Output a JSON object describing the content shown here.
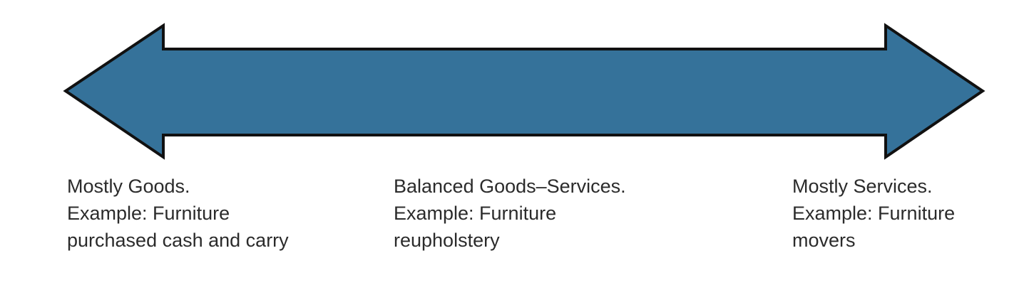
{
  "diagram": {
    "arrow_fill": "#35729A",
    "arrow_stroke": "#111111",
    "text_color": "#2b2b2b",
    "labels": {
      "goods": {
        "title": "Mostly Goods.",
        "example": "Example: Furniture",
        "detail": "purchased cash and carry"
      },
      "balanced": {
        "title": "Balanced Goods–Services.",
        "example": "Example: Furniture",
        "detail": "reupholstery"
      },
      "services": {
        "title": "Mostly Services.",
        "example": "Example: Furniture",
        "detail": "movers"
      }
    }
  }
}
